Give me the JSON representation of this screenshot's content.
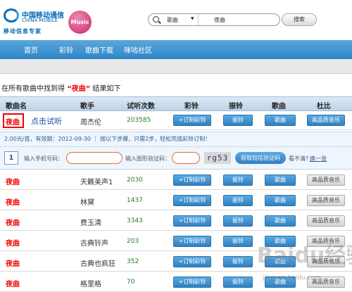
{
  "header": {
    "logo_cn": "中国移动通信",
    "logo_en": "CHINA MOBILE",
    "logo_sub": "移动信息专家",
    "music_badge": "Music",
    "search_category": "歌曲",
    "search_value": "夜曲",
    "search_button": "搜索"
  },
  "nav": {
    "items": [
      "首页",
      "彩铃",
      "歌曲下载",
      "咪咕社区"
    ]
  },
  "result": {
    "prefix": "在所有歌曲中找到得 ",
    "keyword": "“夜曲”",
    "suffix": " 结果如下"
  },
  "table": {
    "headers": [
      "歌曲名",
      "歌手",
      "试听次数",
      "彩铃",
      "振铃",
      "歌曲",
      "杜比"
    ],
    "buttons": {
      "ringback": "+订制彩铃",
      "ringtone": "振铃",
      "song": "歌曲",
      "hq": "高品质音乐"
    },
    "rows": [
      {
        "name": "夜曲",
        "singer": "周杰伦",
        "count": "203585"
      },
      {
        "name": "夜曲",
        "singer": "天籁美声1",
        "count": "2030"
      },
      {
        "name": "夜曲",
        "singer": "林黛",
        "count": "1437"
      },
      {
        "name": "夜曲",
        "singer": "费玉清",
        "count": "3343"
      },
      {
        "name": "夜曲",
        "singer": "古典铃声",
        "count": "203"
      },
      {
        "name": "夜曲",
        "singer": "古典也疯狂",
        "count": "352"
      },
      {
        "name": "夜曲",
        "singer": "格里格",
        "count": "70"
      }
    ]
  },
  "annotation": {
    "click_hint": "点击试听"
  },
  "panel": {
    "info": "2.00元/首，有效期：2012-09-30 ｜ 按以下步骤，只需2步，轻松完成彩铃订制！",
    "step": "1",
    "phone_label": "输入手机号码：",
    "code_label": "输入图形验证码：",
    "captcha": "rg53",
    "get_code": "获取短信验证码",
    "unclear": "看不清?",
    "refresh": "换一张"
  },
  "watermark": {
    "main": "Baidu经验",
    "url": "jingyan.baidu.com"
  },
  "colors": {
    "nav_blue": "#2f86c7",
    "song_red": "#e00000",
    "button_blue": "#3a8fd0"
  }
}
